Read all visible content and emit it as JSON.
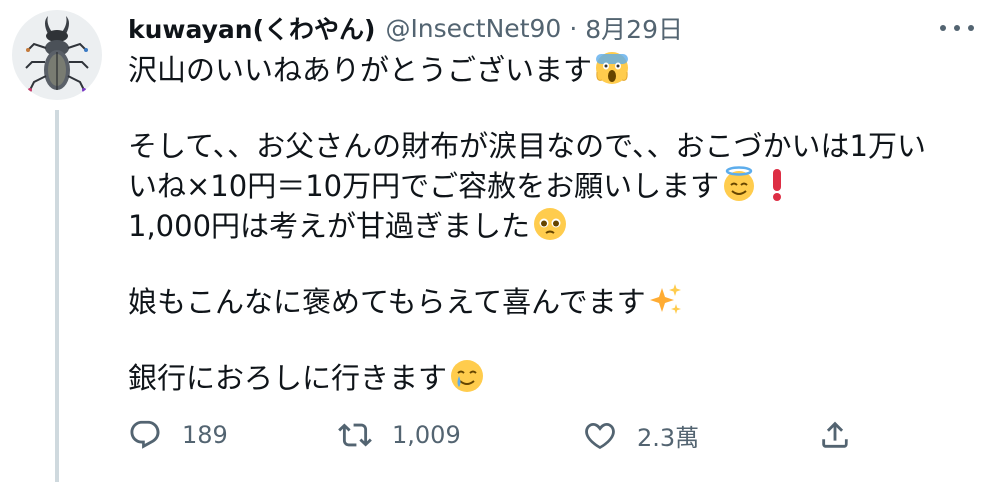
{
  "author": {
    "display_name": "kuwayan(くわやん)",
    "handle": "@InsectNet90",
    "separator": "·",
    "date": "8月29日"
  },
  "tweet": {
    "lines": [
      "沢山のいいねありがとうございます",
      "そして、、お父さんの財布が涙目なので、、おこづかいは1万い",
      "いね×10円＝10万円でご容赦をお願いします",
      "1,000円は考えが甘過ぎました",
      "娘もこんなに褒めてもらえて喜んでます",
      "銀行におろしに行きます"
    ],
    "emojis": [
      "scream-emoji",
      "halo-emoji",
      "exclamation-emoji",
      "pleading-emoji",
      "sparkles-emoji",
      "tear-smile-emoji"
    ]
  },
  "actions": {
    "reply": {
      "icon": "reply-icon",
      "count": "189"
    },
    "retweet": {
      "icon": "retweet-icon",
      "count": "1,009"
    },
    "like": {
      "icon": "heart-icon",
      "count": "2.3萬"
    },
    "share": {
      "icon": "share-icon"
    }
  },
  "colors": {
    "text": "#0f1419",
    "secondary": "#536471",
    "thread_line": "#cfd9de",
    "emoji_yellow": "#ffcc4d",
    "exclamation_red": "#dd2e44"
  }
}
